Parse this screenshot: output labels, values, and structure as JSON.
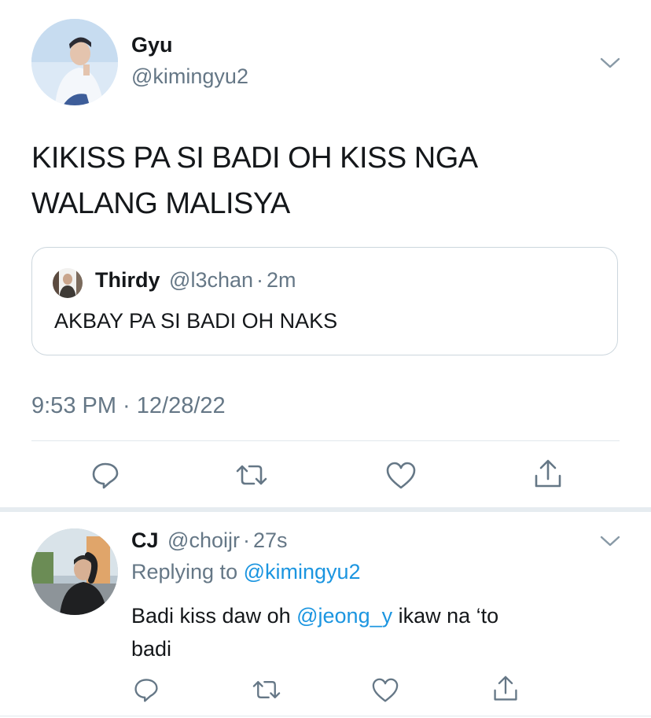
{
  "main_tweet": {
    "author": {
      "display_name": "Gyu",
      "handle": "@kimingyu2"
    },
    "text_lines": [
      "KIKISS PA SI BADI OH KISS NGA",
      "WALANG MALISYA"
    ],
    "quoted_tweet": {
      "author_name": "Thirdy",
      "handle": "@l3chan",
      "separator": "·",
      "time": "2m",
      "text": "AKBAY PA SI BADI OH NAKS"
    },
    "timestamp": "9:53 PM · 12/28/22",
    "actions": [
      "reply-icon",
      "retweet-icon",
      "like-icon",
      "share-icon"
    ]
  },
  "reply_tweet": {
    "author": {
      "display_name": "CJ",
      "handle": "@choijr",
      "separator": "·",
      "time": "27s"
    },
    "replying_to": {
      "prefix": "Replying to ",
      "handle": "@kimingyu2"
    },
    "text": {
      "part1": "Badi kiss daw oh ",
      "mention": "@jeong_y",
      "part2": " ikaw na ‘to",
      "line2": "badi"
    },
    "actions": [
      "reply-icon",
      "retweet-icon",
      "like-icon",
      "share-icon"
    ]
  },
  "colors": {
    "text": "#14171a",
    "muted": "#657786",
    "link": "#1b95e0",
    "border": "#e1e8ed",
    "section_gap": "#e6ecf0"
  }
}
